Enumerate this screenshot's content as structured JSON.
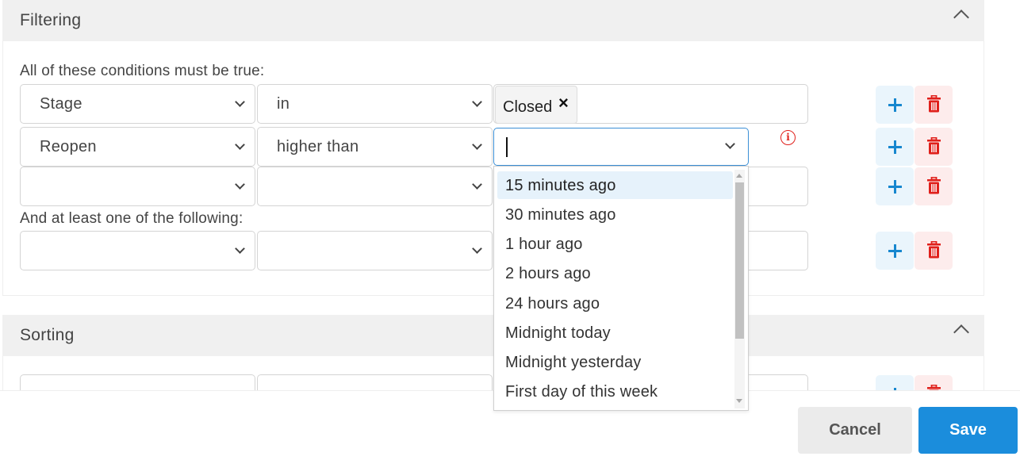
{
  "filtering": {
    "title": "Filtering",
    "all_label": "All of these conditions must be true:",
    "any_label": "And at least one of the following:",
    "rows": [
      {
        "field": "Stage",
        "operator": "in",
        "tag": "Closed"
      },
      {
        "field": "Reopen",
        "operator": "higher than",
        "value": ""
      },
      {
        "field": "",
        "operator": ""
      },
      {
        "field": "",
        "operator": ""
      }
    ],
    "tag_remove_glyph": "×",
    "info_glyph": "i"
  },
  "sorting": {
    "title": "Sorting"
  },
  "dropdown": {
    "options": [
      "15 minutes ago",
      "30 minutes ago",
      "1 hour ago",
      "2 hours ago",
      "24 hours ago",
      "Midnight today",
      "Midnight yesterday",
      "First day of this week"
    ],
    "active_index": 0
  },
  "footer": {
    "cancel_label": "Cancel",
    "save_label": "Save"
  },
  "colors": {
    "accent": "#1b8ddc",
    "add": "#1787cf",
    "delete": "#e0201b",
    "header_bg": "#f0f0f0"
  }
}
